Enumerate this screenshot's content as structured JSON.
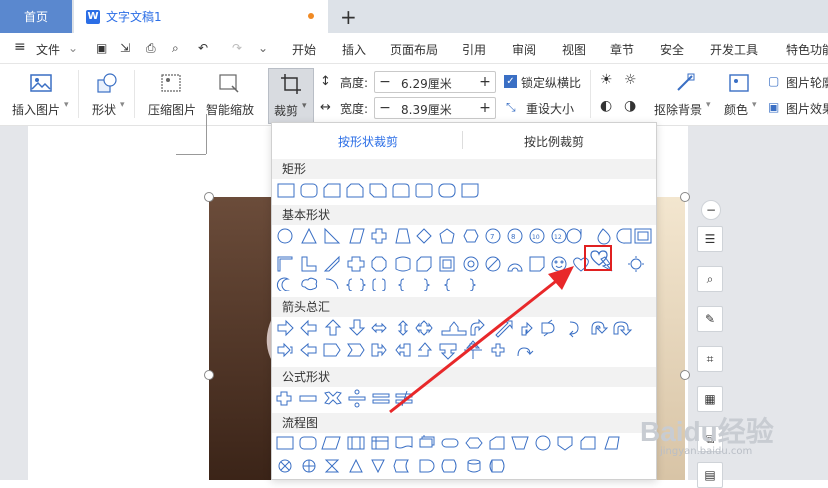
{
  "tabs": {
    "home": "首页",
    "doc": "文字文稿1",
    "new_tab": "+"
  },
  "menu": {
    "file": "文件",
    "items": [
      "开始",
      "插入",
      "页面布局",
      "引用",
      "审阅",
      "视图",
      "章节",
      "安全",
      "开发工具",
      "特色功能"
    ]
  },
  "ribbon": {
    "insert_image": "插入图片",
    "shape": "形状",
    "compress": "压缩图片",
    "smart_zoom": "智能缩放",
    "crop": "裁剪",
    "height_label": "高度:",
    "height_value": "6.29厘米",
    "width_label": "宽度:",
    "width_value": "8.39厘米",
    "lock_ratio": "锁定纵横比",
    "reset_size": "重设大小",
    "remove_bg": "抠除背景",
    "color": "颜色",
    "image_outline": "图片轮廓",
    "image_effect": "图片效果"
  },
  "dropdown": {
    "tab_shape_crop": "按形状裁剪",
    "tab_ratio_crop": "按比例裁剪",
    "sections": {
      "rect": "矩形",
      "basic": "基本形状",
      "arrows": "箭头总汇",
      "formula": "公式形状",
      "flowchart": "流程图"
    },
    "highlight_shape": "heart",
    "highlight_color": "#e02020"
  },
  "colors": {
    "accent": "#5a88cf",
    "selected_tab_text": "#2b6ee6"
  },
  "watermark": {
    "main": "Baidu经验",
    "sub": "jingyan.baidu.com"
  }
}
